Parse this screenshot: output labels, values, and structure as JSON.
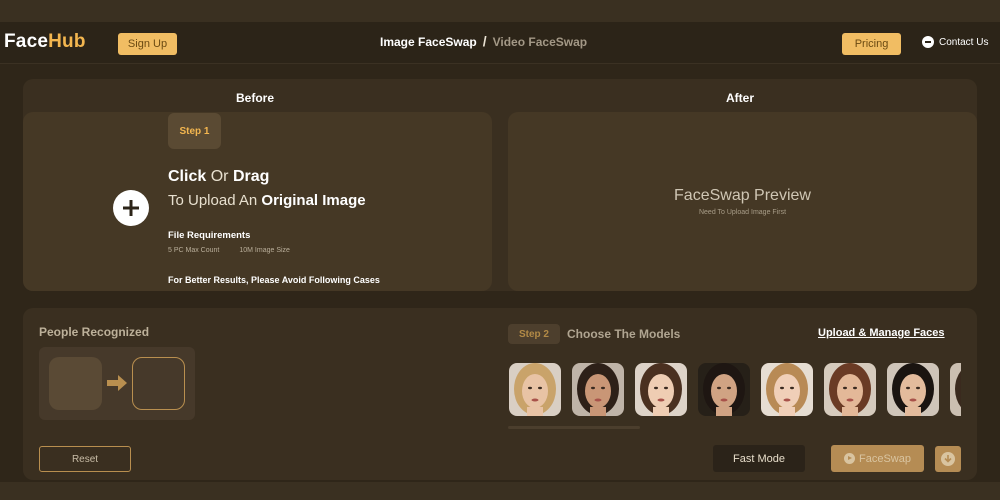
{
  "header": {
    "logo_face": "Face",
    "logo_hub": "Hub",
    "signup_label": "Sign Up",
    "nav_active": "Image FaceSwap",
    "nav_separator": "/",
    "nav_inactive": "Video FaceSwap",
    "pricing_label": "Pricing",
    "contact_label": "Contact Us"
  },
  "before": {
    "label": "Before",
    "step_label": "Step 1",
    "line1_bold1": "Click",
    "line1_light": "Or",
    "line1_bold2": "Drag",
    "line2_light": "To Upload An",
    "line2_bold": "Original Image",
    "file_req_title": "File Requirements",
    "file_req_count": "5 PC Max Count",
    "file_req_size": "10M Image Size",
    "better_results": "For Better Results, Please Avoid Following Cases"
  },
  "after": {
    "label": "After",
    "preview_title": "FaceSwap Preview",
    "preview_sub": "Need To Upload Image First"
  },
  "people": {
    "title": "People Recognized",
    "reset_label": "Reset"
  },
  "models": {
    "step_label": "Step 2",
    "title": "Choose The Models",
    "upload_manage_label": "Upload & Manage Faces",
    "thumbnails": [
      {
        "hair": "#c9a36a",
        "skin": "#e8c3a5",
        "bg": "#d9cfc4"
      },
      {
        "hair": "#2d2018",
        "skin": "#c99676",
        "bg": "#bfb4a8"
      },
      {
        "hair": "#4a3020",
        "skin": "#efcdb3",
        "bg": "#ddd3c8"
      },
      {
        "hair": "#1e1612",
        "skin": "#d0a383",
        "bg": "#262018"
      },
      {
        "hair": "#b88a55",
        "skin": "#f0cfb8",
        "bg": "#e6ddd2"
      },
      {
        "hair": "#6a3b25",
        "skin": "#e3b898",
        "bg": "#d6cbbd"
      },
      {
        "hair": "#1a1410",
        "skin": "#e3bb9c",
        "bg": "#cfc5b9"
      },
      {
        "hair": "#3a2a1e",
        "skin": "#d7ae90",
        "bg": "#cbbfb1"
      }
    ]
  },
  "actions": {
    "fast_mode_label": "Fast Mode",
    "faceswap_label": "FaceSwap"
  },
  "colors": {
    "accent": "#f1bd63",
    "background": "#2f2619",
    "panel": "#3a2f20"
  }
}
